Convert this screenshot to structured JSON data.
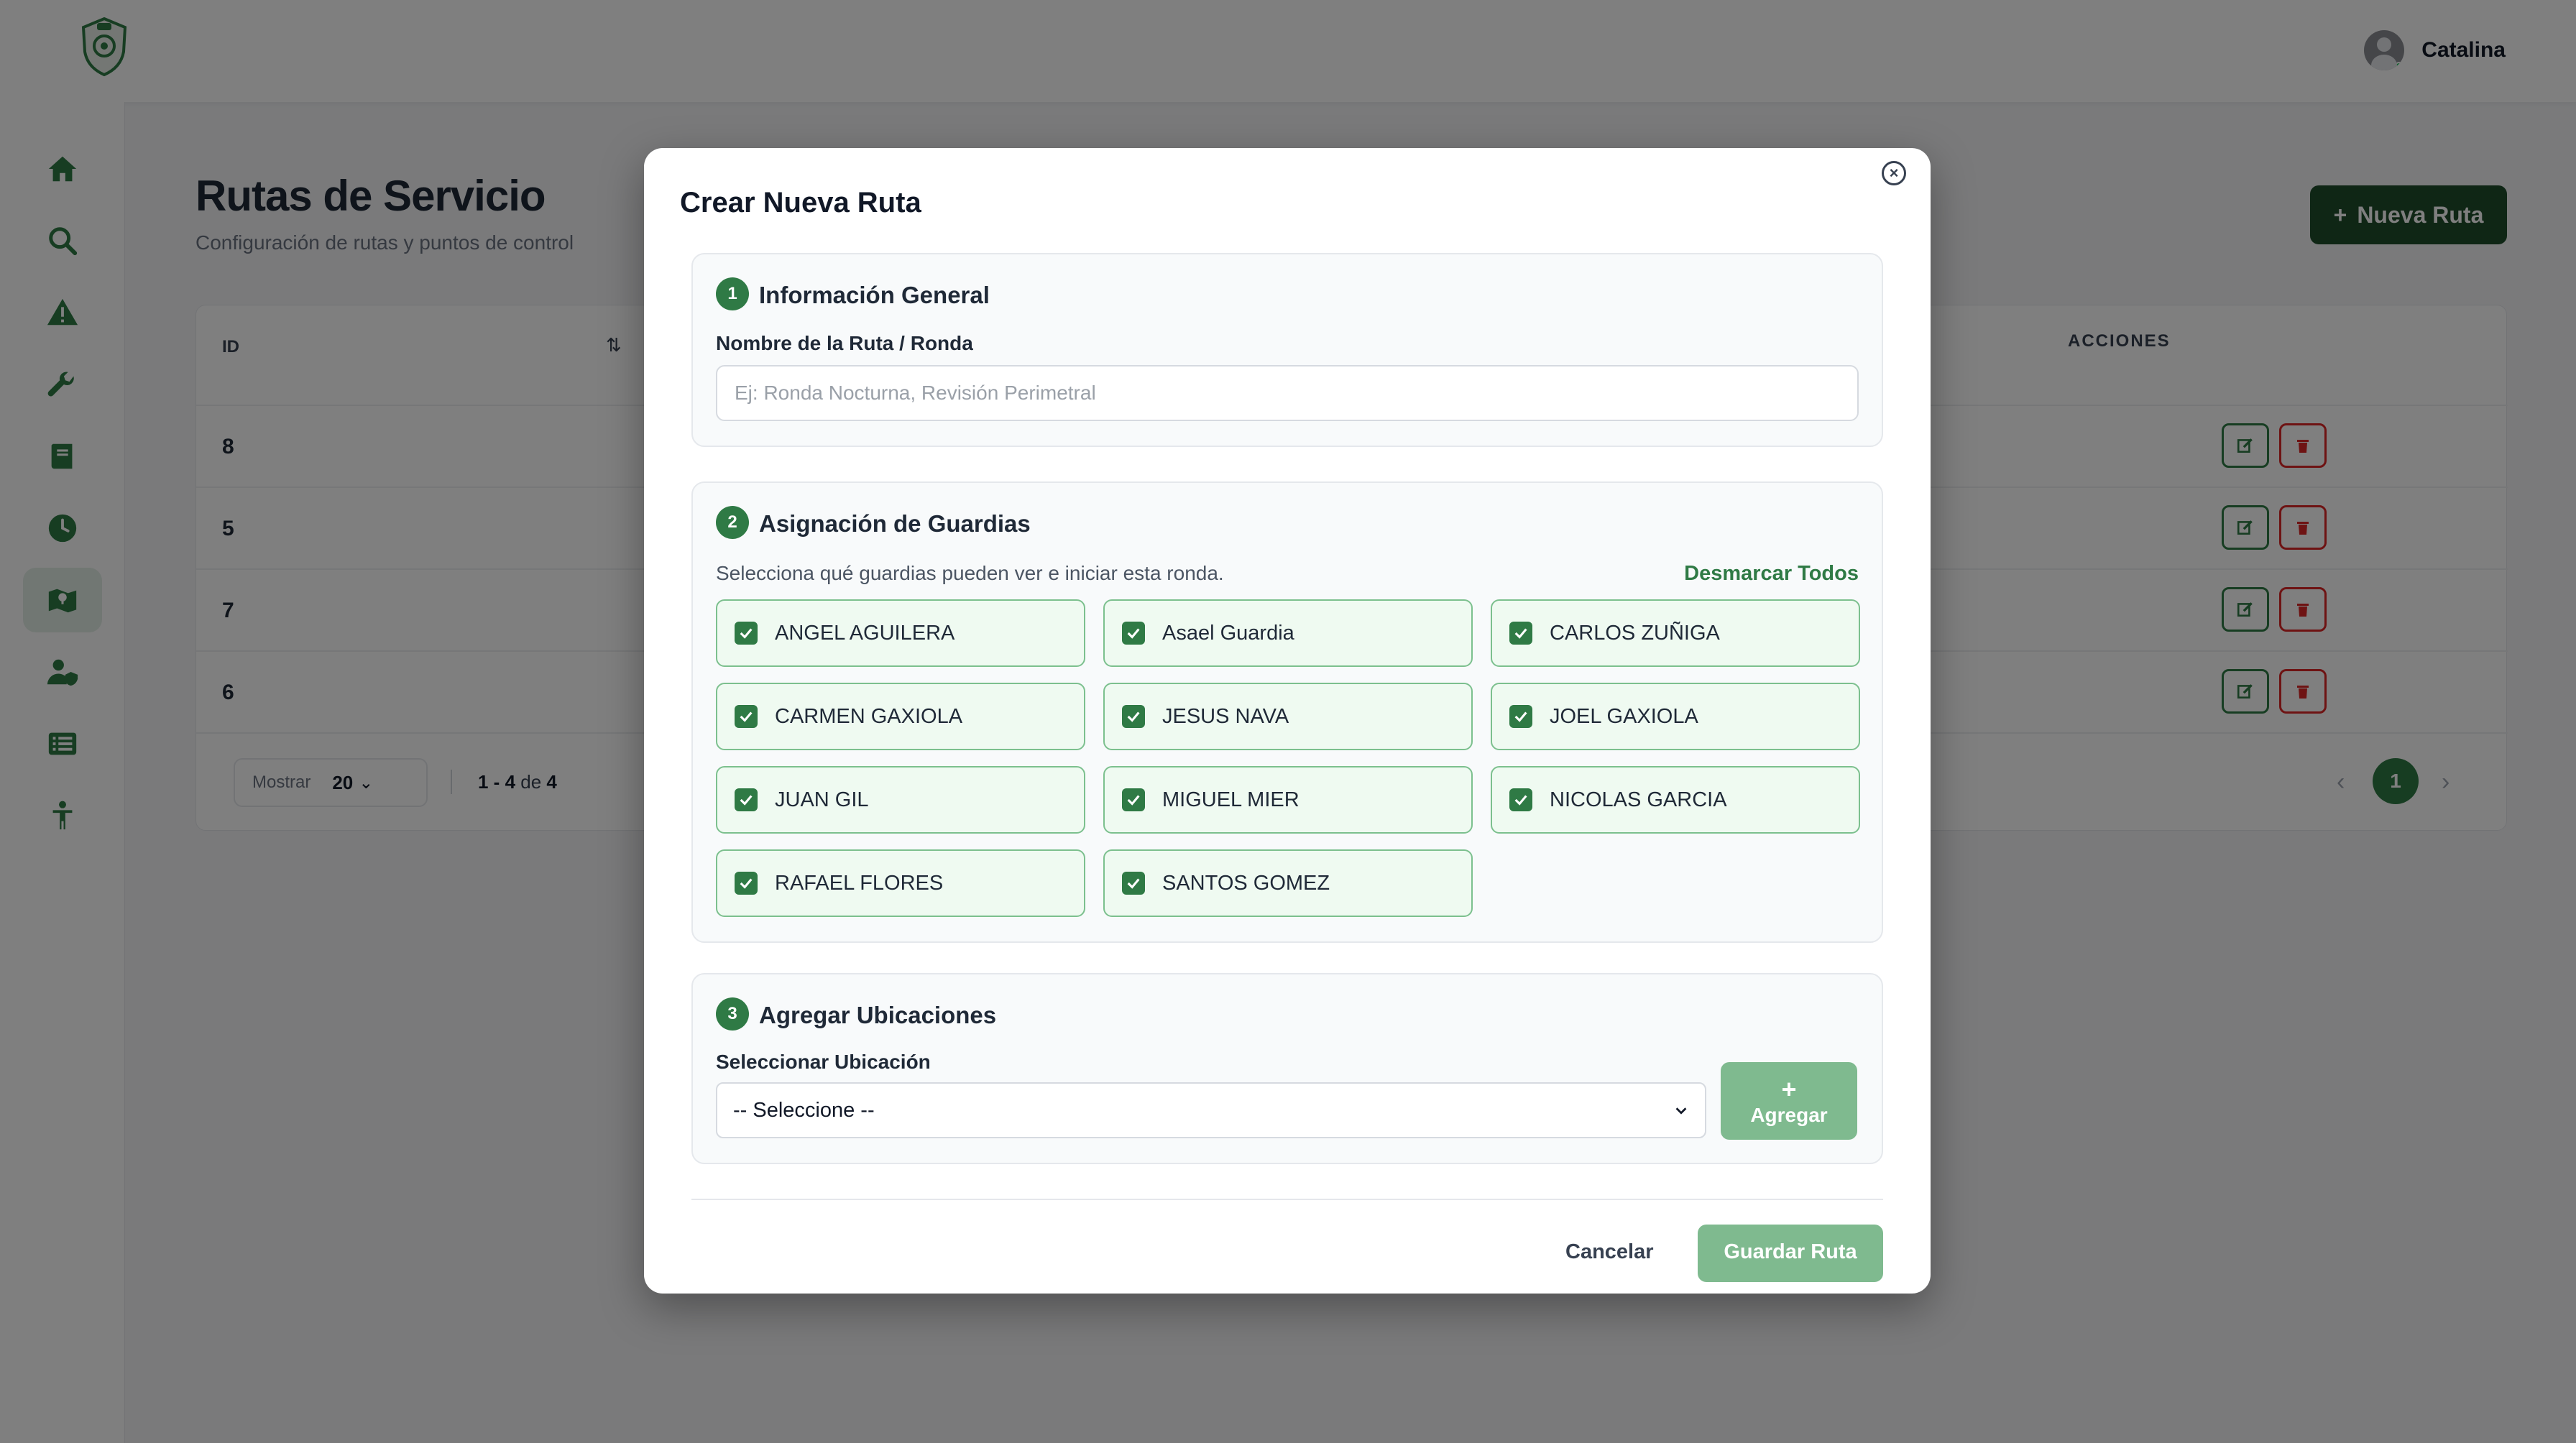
{
  "app": {
    "user_name": "Catalina"
  },
  "sidebar": {
    "items": [
      {
        "icon": "home-icon",
        "active": false
      },
      {
        "icon": "search-icon",
        "active": false
      },
      {
        "icon": "warning-icon",
        "active": false
      },
      {
        "icon": "wrench-icon",
        "active": false
      },
      {
        "icon": "book-icon",
        "active": false
      },
      {
        "icon": "clock-icon",
        "active": false
      },
      {
        "icon": "map-icon",
        "active": true
      },
      {
        "icon": "user-shield-icon",
        "active": false
      },
      {
        "icon": "list-icon",
        "active": false
      },
      {
        "icon": "person-icon",
        "active": false
      }
    ]
  },
  "page": {
    "title": "Rutas de Servicio",
    "subtitle": "Configuración de rutas y puntos de control",
    "new_button": "Nueva Ruta"
  },
  "table": {
    "col_id": "ID",
    "col_actions": "ACCIONES",
    "rows": [
      "8",
      "5",
      "7",
      "6"
    ],
    "pager_show": "Mostrar",
    "pager_size": "20",
    "pager_range": "1 - 4",
    "pager_of": "de",
    "pager_total": "4",
    "current_page": "1"
  },
  "modal": {
    "title": "Crear Nueva Ruta",
    "section1": {
      "num": "1",
      "title": "Información General",
      "name_label": "Nombre de la Ruta / Ronda",
      "name_placeholder": "Ej: Ronda Nocturna, Revisión Perimetral",
      "name_value": ""
    },
    "section2": {
      "num": "2",
      "title": "Asignación de Guardias",
      "helper": "Selecciona qué guardias pueden ver e iniciar esta ronda.",
      "toggle_all": "Desmarcar Todos",
      "guards": [
        {
          "name": "ANGEL AGUILERA",
          "checked": true
        },
        {
          "name": "Asael Guardia",
          "checked": true
        },
        {
          "name": "CARLOS ZUÑIGA",
          "checked": true
        },
        {
          "name": "CARMEN GAXIOLA",
          "checked": true
        },
        {
          "name": "JESUS NAVA",
          "checked": true
        },
        {
          "name": "JOEL GAXIOLA",
          "checked": true
        },
        {
          "name": "JUAN GIL",
          "checked": true
        },
        {
          "name": "MIGUEL MIER",
          "checked": true
        },
        {
          "name": "NICOLAS GARCIA",
          "checked": true
        },
        {
          "name": "RAFAEL FLORES",
          "checked": true
        },
        {
          "name": "SANTOS GOMEZ",
          "checked": true
        }
      ]
    },
    "section3": {
      "num": "3",
      "title": "Agregar Ubicaciones",
      "select_label": "Seleccionar Ubicación",
      "select_value": "-- Seleccione --",
      "add_button": "Agregar"
    },
    "cancel": "Cancelar",
    "save": "Guardar Ruta"
  },
  "colors": {
    "accent": "#2f7a45",
    "dark_accent": "#1f4d2b",
    "danger": "#dc2626",
    "disabled_green": "#7fba8f"
  }
}
